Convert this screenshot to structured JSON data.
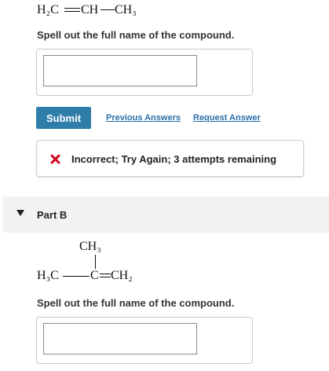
{
  "part_a": {
    "formula": {
      "h2c": "H₂C",
      "ch": "CH",
      "ch3": "CH₃"
    },
    "prompt": "Spell out the full name of the compound.",
    "answer": {
      "value": "",
      "placeholder": ""
    },
    "submit_label": "Submit",
    "previous_answers_label": "Previous Answers",
    "request_answer_label": "Request Answer",
    "feedback": {
      "icon": "x-icon",
      "text": "Incorrect; Try Again; 3 attempts remaining",
      "color": "#d0021b"
    }
  },
  "part_b": {
    "toggle_icon": "triangle-down-icon",
    "label": "Part B",
    "formula": {
      "top": "CH₃",
      "left": "H₃C",
      "center": "C",
      "right": "CH₂"
    },
    "prompt": "Spell out the full name of the compound.",
    "answer": {
      "value": "",
      "placeholder": ""
    }
  },
  "colors": {
    "submit_bg": "#2f7eaa",
    "link": "#2a6fa8",
    "error": "#d0021b"
  }
}
